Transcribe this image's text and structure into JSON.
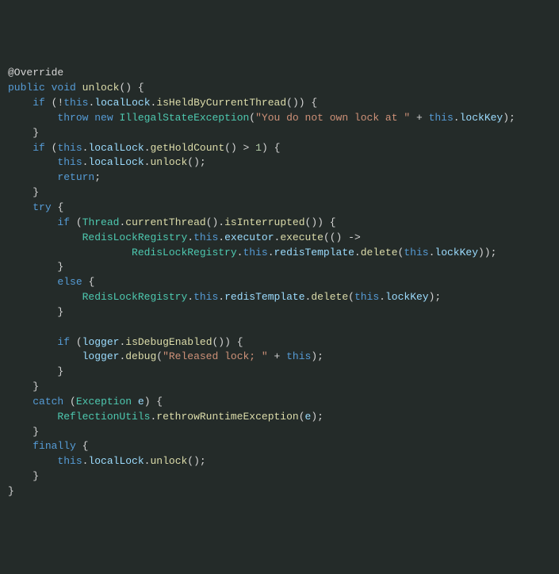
{
  "code": {
    "annotation": "@Override",
    "kw_public": "public",
    "kw_void": "void",
    "mth_unlock": "unlock",
    "kw_if": "if",
    "kw_this": "this",
    "var_localLock": "localLock",
    "mth_isHeld": "isHeldByCurrentThread",
    "kw_throw": "throw",
    "kw_new": "new",
    "typ_IllegalState": "IllegalStateException",
    "str_ownLock": "\"You do not own lock at \"",
    "var_lockKey": "lockKey",
    "mth_getHoldCount": "getHoldCount",
    "num_one": "1",
    "kw_return": "return",
    "kw_try": "try",
    "typ_Thread": "Thread",
    "mth_currentThread": "currentThread",
    "mth_isInterrupted": "isInterrupted",
    "typ_RedisLockRegistry": "RedisLockRegistry",
    "var_executor": "executor",
    "mth_execute": "execute",
    "var_redisTemplate": "redisTemplate",
    "mth_delete": "delete",
    "kw_else": "else",
    "var_logger": "logger",
    "mth_isDebugEnabled": "isDebugEnabled",
    "mth_debug": "debug",
    "str_released": "\"Released lock; \"",
    "kw_catch": "catch",
    "typ_Exception": "Exception",
    "var_e": "e",
    "typ_ReflectionUtils": "ReflectionUtils",
    "mth_rethrow": "rethrowRuntimeException",
    "kw_finally": "finally"
  }
}
